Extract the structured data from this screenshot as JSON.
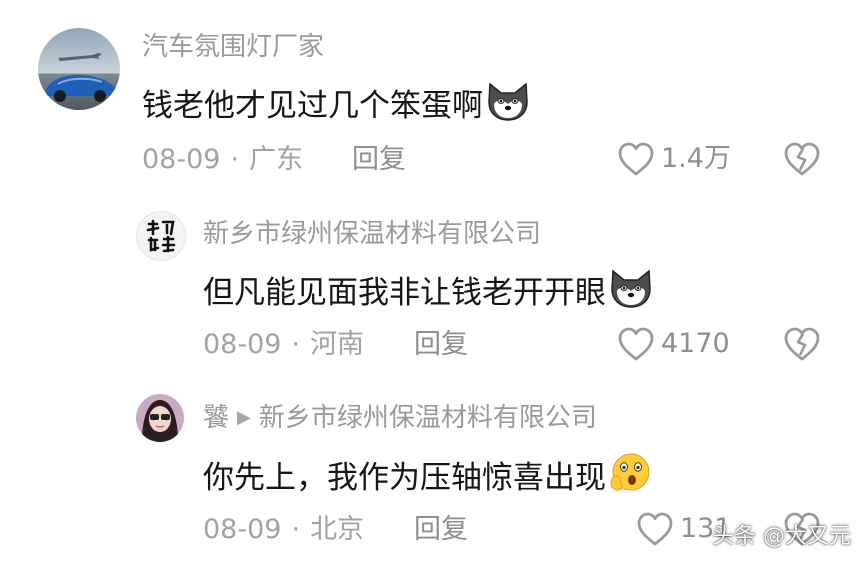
{
  "comments": [
    {
      "author": "汽车氛围灯厂家",
      "text": "钱老他才见过几个笨蛋啊",
      "date": "08-09",
      "separator": "·",
      "location": "广东",
      "reply_label": "回复",
      "likes": "1.4万",
      "emoji": "dog-face-icon"
    },
    {
      "author": "新乡市绿州保温材料有限公司",
      "text": "但凡能见面我非让钱老开开眼",
      "date": "08-09",
      "separator": "·",
      "location": "河南",
      "reply_label": "回复",
      "likes": "4170",
      "emoji": "dog-face-icon"
    },
    {
      "author": "饕",
      "reply_to": "新乡市绿州保温材料有限公司",
      "text": "你先上，我作为压轴惊喜出现",
      "date": "08-09",
      "separator": "·",
      "location": "北京",
      "reply_label": "回复",
      "likes": "131",
      "emoji": "shocked-face-icon"
    }
  ],
  "watermark": "头条 @大又元",
  "colors": {
    "text": "#161616",
    "meta": "#a3a3a3",
    "name": "#9a9a9a"
  }
}
